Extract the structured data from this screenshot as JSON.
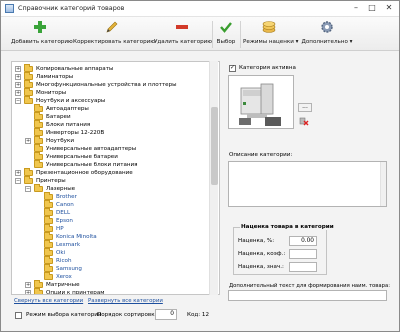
{
  "window": {
    "title": "Справочник категорий товаров",
    "minimize": "–",
    "maximize": "□",
    "close": "✕"
  },
  "toolbar": {
    "add_label": "Добавить категорию",
    "edit_label": "Корректировать категорию",
    "delete_label": "Удалить категорию",
    "select_label": "Выбор",
    "markup_label": "Режимы наценки ▾",
    "more_label": "Дополнительно ▾"
  },
  "tree": {
    "items": [
      {
        "label": "Копировальные аппараты",
        "expander": "+"
      },
      {
        "label": "Ламинаторы",
        "expander": "+"
      },
      {
        "label": "Многофункциональные устройства и плоттеры",
        "expander": "+"
      },
      {
        "label": "Мониторы",
        "expander": "+"
      },
      {
        "label": "Ноутбуки и аксессуары",
        "expander": "−"
      },
      {
        "label": "Автоадаптеры",
        "expander": ""
      },
      {
        "label": "Батареи",
        "expander": ""
      },
      {
        "label": "Блоки питания",
        "expander": ""
      },
      {
        "label": "Инверторы 12-220В",
        "expander": ""
      },
      {
        "label": "Ноутбуки",
        "expander": "+"
      },
      {
        "label": "Универсальные автоадаптеры",
        "expander": ""
      },
      {
        "label": "Универсальные батареи",
        "expander": ""
      },
      {
        "label": "Универсальные блоки питания",
        "expander": ""
      },
      {
        "label": "Презентационное оборудование",
        "expander": "+"
      },
      {
        "label": "Принтеры",
        "expander": "−"
      },
      {
        "label": "Лазерные",
        "expander": "−"
      },
      {
        "label": "Brother",
        "expander": ""
      },
      {
        "label": "Canon",
        "expander": ""
      },
      {
        "label": "DELL",
        "expander": ""
      },
      {
        "label": "Epson",
        "expander": ""
      },
      {
        "label": "HP",
        "expander": ""
      },
      {
        "label": "Konica Minolta",
        "expander": ""
      },
      {
        "label": "Lexmark",
        "expander": ""
      },
      {
        "label": "Oki",
        "expander": ""
      },
      {
        "label": "Ricoh",
        "expander": ""
      },
      {
        "label": "Samsung",
        "expander": ""
      },
      {
        "label": "Xerox",
        "expander": ""
      },
      {
        "label": "Матричные",
        "expander": "+"
      },
      {
        "label": "Опции к принтерам",
        "expander": "+"
      }
    ],
    "collapse_all": "Свернуть все категории",
    "expand_all": "Развернуть все категории"
  },
  "bottom": {
    "select_mode_label": "Режим выбора категорий",
    "sort_label": "Порядок сортировки:",
    "sort_value": "0",
    "code_label": "Код: 12"
  },
  "details": {
    "active_label": "Категория активна",
    "image_button": "...",
    "description_label": "Описание категории:",
    "markup_title": "Наценка товара в категории",
    "markup_percent_label": "Наценка, %:",
    "markup_percent_value": "0.00",
    "markup_coef_label": "Наценка, коэф.:",
    "markup_coef_value": "",
    "markup_value_label": "Наценка, знач.:",
    "markup_value_value": "",
    "extra_text_label": "Дополнительный текст для формирования наим. товара:"
  }
}
